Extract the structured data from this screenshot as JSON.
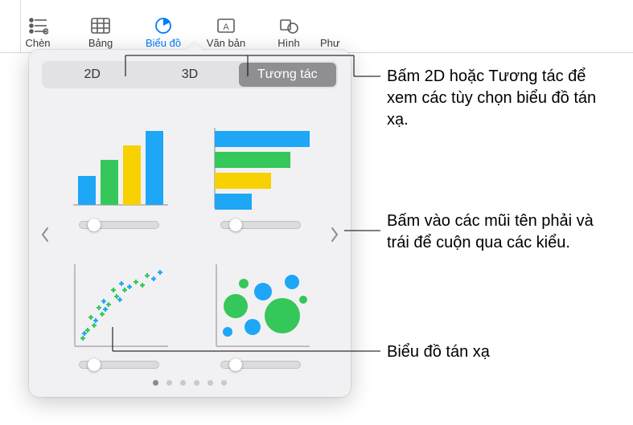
{
  "toolbar": {
    "items": [
      {
        "label": "Chèn"
      },
      {
        "label": "Bảng"
      },
      {
        "label": "Biểu đồ"
      },
      {
        "label": "Văn bản"
      },
      {
        "label": "Hình"
      },
      {
        "label": "Phư"
      }
    ]
  },
  "popover": {
    "tabs": [
      "2D",
      "3D",
      "Tương tác"
    ],
    "page_count": 6
  },
  "callouts": {
    "tabs": "Bấm 2D hoặc Tương tác để xem các tùy chọn biểu đồ tán xạ.",
    "arrows": "Bấm vào các mũi tên phải và trái để cuộn qua các kiểu.",
    "scatter": "Biểu đồ tán xạ"
  },
  "colors": {
    "blue": "#1ea6f7",
    "green": "#35c759",
    "yellow": "#f7d100"
  }
}
